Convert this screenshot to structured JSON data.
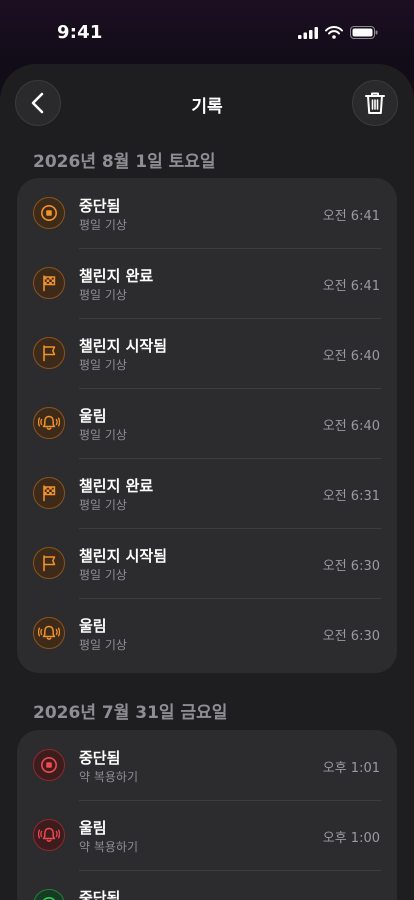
{
  "status_bar": {
    "time": "9:41"
  },
  "header": {
    "title": "기록"
  },
  "sections": [
    {
      "date": "2026년 8월 1일 토요일",
      "items": [
        {
          "icon": "stop-icon",
          "title": "중단됨",
          "subtitle": "평일 기상",
          "time": "오전 6:41",
          "color": "orange"
        },
        {
          "icon": "checkered-flag-icon",
          "title": "챌린지 완료",
          "subtitle": "평일 기상",
          "time": "오전 6:41",
          "color": "orange"
        },
        {
          "icon": "flag-icon",
          "title": "챌린지 시작됨",
          "subtitle": "평일 기상",
          "time": "오전 6:40",
          "color": "orange"
        },
        {
          "icon": "ringing-bell-icon",
          "title": "울림",
          "subtitle": "평일 기상",
          "time": "오전 6:40",
          "color": "orange"
        },
        {
          "icon": "checkered-flag-icon",
          "title": "챌린지 완료",
          "subtitle": "평일 기상",
          "time": "오전 6:31",
          "color": "orange"
        },
        {
          "icon": "flag-icon",
          "title": "챌린지 시작됨",
          "subtitle": "평일 기상",
          "time": "오전 6:30",
          "color": "orange"
        },
        {
          "icon": "ringing-bell-icon",
          "title": "울림",
          "subtitle": "평일 기상",
          "time": "오전 6:30",
          "color": "orange"
        }
      ]
    },
    {
      "date": "2026년 7월 31일 금요일",
      "items": [
        {
          "icon": "stop-icon",
          "title": "중단됨",
          "subtitle": "약 복용하기",
          "time": "오후 1:01",
          "color": "red"
        },
        {
          "icon": "ringing-bell-icon",
          "title": "울림",
          "subtitle": "약 복용하기",
          "time": "오후 1:00",
          "color": "red"
        },
        {
          "icon": "stop-icon",
          "title": "중단됨",
          "subtitle": "",
          "time": "",
          "color": "green"
        }
      ]
    }
  ],
  "colors": {
    "orange": "#f0922e",
    "red": "#ee4a50",
    "green": "#34c759"
  }
}
